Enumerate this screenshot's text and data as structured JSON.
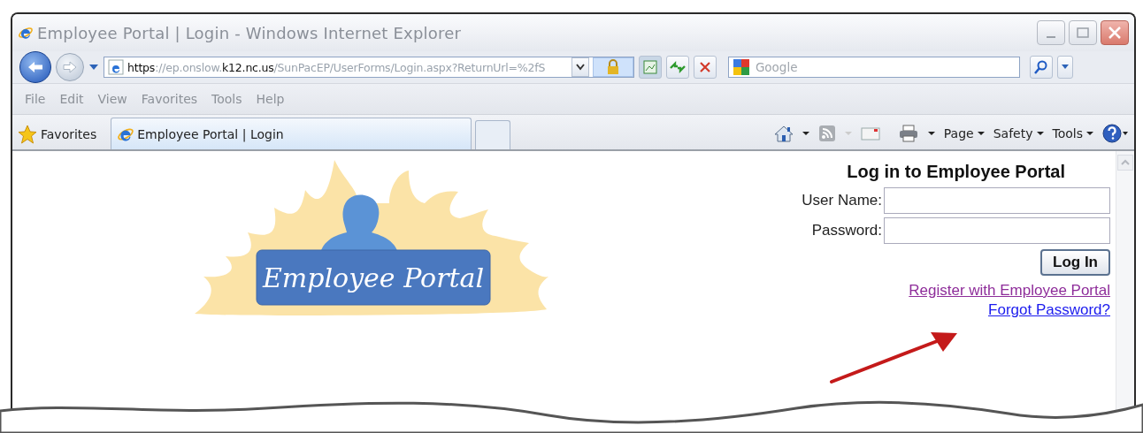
{
  "window": {
    "title": "Employee Portal | Login - Windows Internet Explorer"
  },
  "address_bar": {
    "url": "**https**://ep.onslow.**k12.nc.us**/SunPacEP/UserForms/Login.aspx?ReturnUrl=%2fS"
  },
  "search": {
    "placeholder": "Google"
  },
  "menu": [
    "File",
    "Edit",
    "View",
    "Favorites",
    "Tools",
    "Help"
  ],
  "favorites_bar": {
    "label": "Favorites",
    "tabs": [
      {
        "label": "Employee Portal | Login",
        "selected": true
      }
    ]
  },
  "command_bar": [
    "Page",
    "Safety",
    "Tools"
  ],
  "page": {
    "logo_text": "Employee Portal",
    "heading": "Log in to Employee Portal",
    "fields": [
      {
        "label": "User Name:"
      },
      {
        "label": "Password:"
      }
    ],
    "button": "Log In",
    "links": [
      {
        "text": "Register with Employee Portal",
        "visited": true
      },
      {
        "text": "Forgot Password?",
        "visited": false
      }
    ]
  }
}
